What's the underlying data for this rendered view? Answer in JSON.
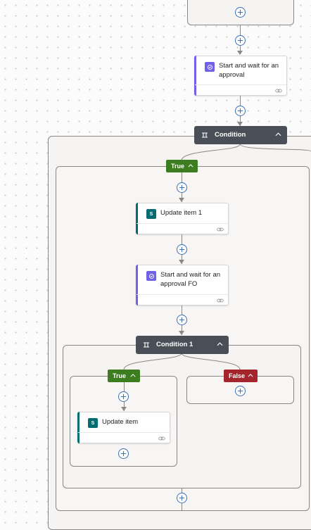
{
  "canvas": {
    "top_card": {
      "add_label": "+"
    },
    "approval_card": {
      "title": "Start and wait for an approval",
      "icon": "approval-icon"
    },
    "condition": {
      "label": "Condition",
      "true_branch": {
        "label": "True",
        "update_card": {
          "title": "Update item 1",
          "icon": "sharepoint-icon"
        },
        "approval_card": {
          "title": "Start and wait for an approval FO",
          "icon": "approval-icon"
        },
        "condition1": {
          "label": "Condition 1",
          "true_branch": {
            "label": "True",
            "update_card": {
              "title": "Update item",
              "icon": "sharepoint-icon"
            }
          },
          "false_branch": {
            "label": "False"
          }
        }
      }
    }
  },
  "colors": {
    "approval": "#7160e8",
    "sharepoint": "#036c70",
    "condition_header": "#4a4f57",
    "true_pill": "#3c7d1f",
    "false_pill": "#a4262c",
    "add_button": "#3b6fb6"
  }
}
